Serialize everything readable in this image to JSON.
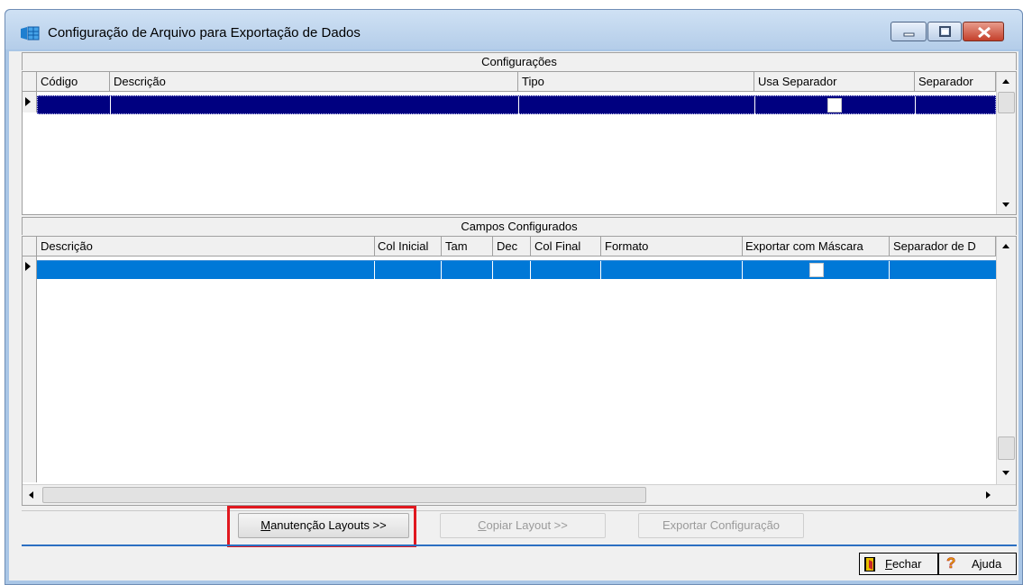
{
  "window": {
    "title": "Configuração de Arquivo para Exportação de Dados",
    "accent": "#2b6fc2",
    "selection_dark": "#000080",
    "selection_light": "#0078d7"
  },
  "configuracoes": {
    "caption": "Configurações",
    "columns": [
      "Código",
      "Descrição",
      "Tipo",
      "Usa Separador",
      "Separador"
    ],
    "rows": [
      {
        "codigo": "",
        "descricao": "",
        "tipo": "",
        "usa_separador": false,
        "separador": ""
      }
    ]
  },
  "campos": {
    "caption": "Campos Configurados",
    "columns": [
      "Descrição",
      "Col Inicial",
      "Tam",
      "Dec",
      "Col Final",
      "Formato",
      "Exportar com Máscara",
      "Separador de D"
    ],
    "rows": [
      {
        "descricao": "",
        "col_inicial": "",
        "tam": "",
        "dec": "",
        "col_final": "",
        "formato": "",
        "exportar_mascara": false,
        "separador_d": ""
      }
    ]
  },
  "buttons": {
    "manutencao": {
      "prefix": "M",
      "rest": "anutenção Layouts >>"
    },
    "copiar": {
      "prefix": "C",
      "rest": "opiar Layout >>"
    },
    "exportar": "Exportar Configuração",
    "fechar": {
      "prefix": "F",
      "rest": "echar"
    },
    "ajuda": "Ajuda"
  },
  "icons": {
    "app": "data-grid-icon",
    "fechar": "exit-door-icon",
    "ajuda": "question-mark-icon"
  }
}
